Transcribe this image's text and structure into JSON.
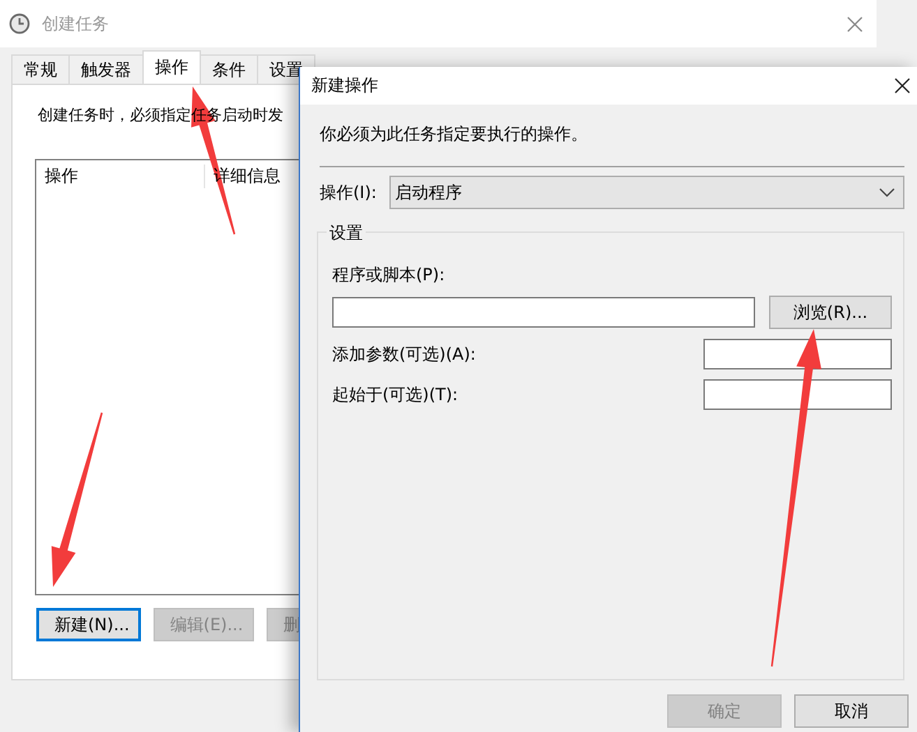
{
  "back_window": {
    "title": "创建任务",
    "tabs": [
      {
        "label": "常规",
        "selected": false
      },
      {
        "label": "触发器",
        "selected": false
      },
      {
        "label": "操作",
        "selected": true
      },
      {
        "label": "条件",
        "selected": false
      },
      {
        "label": "设置",
        "selected": false
      }
    ],
    "description": "创建任务时，必须指定任务启动时发",
    "list": {
      "columns": [
        "操作",
        "详细信息"
      ]
    },
    "buttons": [
      {
        "label": "新建(N)...",
        "disabled": false,
        "focused": true
      },
      {
        "label": "编辑(E)...",
        "disabled": true,
        "focused": false
      },
      {
        "label": "删",
        "disabled": true,
        "focused": false
      }
    ]
  },
  "dialog": {
    "title": "新建操作",
    "instruction": "你必须为此任务指定要执行的操作。",
    "action": {
      "label": "操作(I):",
      "value": "启动程序"
    },
    "group": {
      "title": "设置",
      "fields": [
        {
          "kind": "stacked",
          "label": "程序或脚本(P):",
          "button": "浏览(R)..."
        },
        {
          "kind": "inline",
          "label": "添加参数(可选)(A):"
        },
        {
          "kind": "inline",
          "label": "起始于(可选)(T):"
        }
      ]
    },
    "buttons": [
      {
        "label": "确定",
        "disabled": true
      },
      {
        "label": "取消",
        "disabled": false
      }
    ]
  }
}
